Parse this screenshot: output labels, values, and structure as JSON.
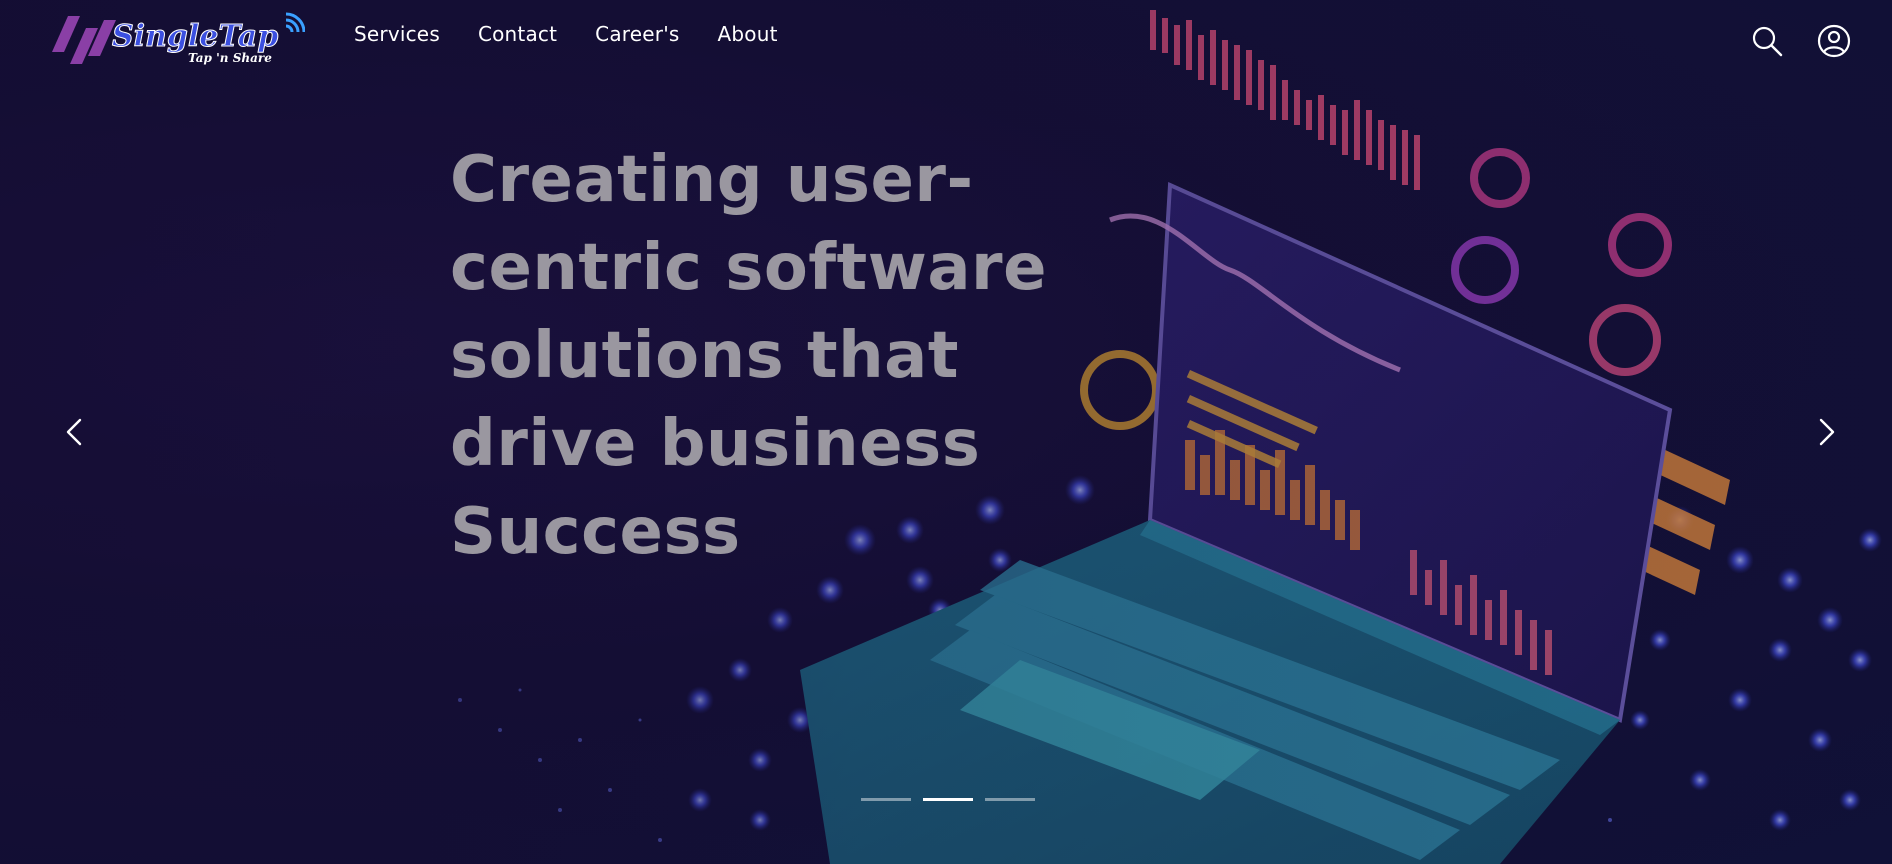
{
  "brand": {
    "name": "SingleTap",
    "tagline": "Tap 'n Share",
    "logo_icon": "signal-waves-icon",
    "colors": {
      "primary": "#3b4fe0",
      "mark": "#8a3fa6"
    }
  },
  "nav": {
    "items": [
      {
        "label": "Services"
      },
      {
        "label": "Contact"
      },
      {
        "label": "Career's"
      },
      {
        "label": "About"
      }
    ]
  },
  "header_actions": {
    "search_icon": "search-icon",
    "account_icon": "user-account-icon"
  },
  "hero": {
    "headline": "Creating user-centric software solutions that drive business Success",
    "prev_icon": "chevron-left-icon",
    "next_icon": "chevron-right-icon",
    "slides": {
      "count": 3,
      "active_index": 1
    }
  }
}
